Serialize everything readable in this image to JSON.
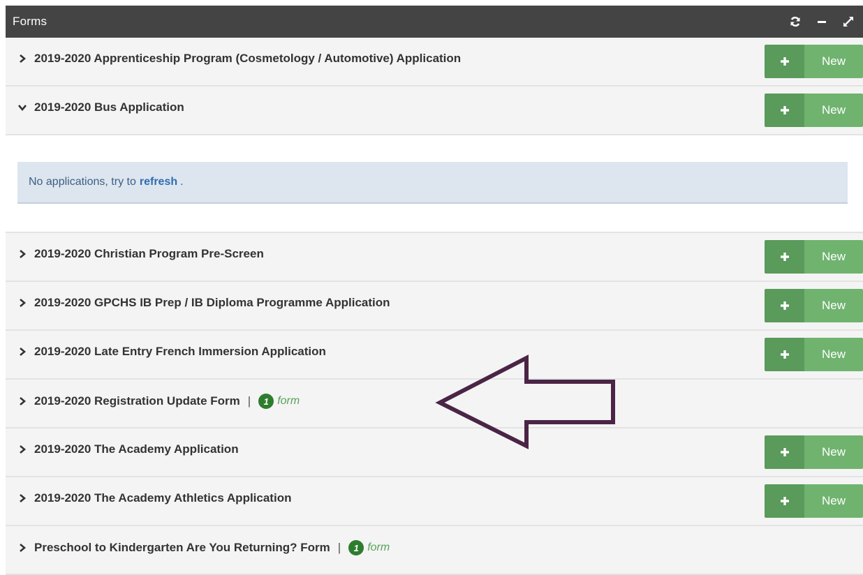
{
  "panel": {
    "title": "Forms",
    "tools": [
      "refresh-icon",
      "minimize-icon",
      "expand-icon"
    ]
  },
  "new_button_label": "New",
  "colors": {
    "header_bg": "#444444",
    "button_dark": "#5a9a5a",
    "button_light": "#6fb36f",
    "badge": "#2e7d2e",
    "arrow": "#4a2545",
    "alert_bg": "#dde5ef"
  },
  "forms": [
    {
      "title": "2019-2020 Apprenticeship Program (Cosmetology / Automotive) Application",
      "expanded": false,
      "has_new": true
    },
    {
      "title": "2019-2020 Bus Application",
      "expanded": true,
      "has_new": true
    },
    {
      "title": "2019-2020 Christian Program Pre-Screen",
      "expanded": false,
      "has_new": true
    },
    {
      "title": "2019-2020 GPCHS IB Prep / IB Diploma Programme Application",
      "expanded": false,
      "has_new": true
    },
    {
      "title": "2019-2020 Late Entry French Immersion Application",
      "expanded": false,
      "has_new": true
    },
    {
      "title": "2019-2020 Registration Update Form",
      "expanded": false,
      "has_new": false,
      "separator": "|",
      "count": "1",
      "count_label": "form"
    },
    {
      "title": "2019-2020 The Academy Application",
      "expanded": false,
      "has_new": true
    },
    {
      "title": "2019-2020 The Academy Athletics Application",
      "expanded": false,
      "has_new": true
    },
    {
      "title": "Preschool to Kindergarten Are You Returning? Form",
      "expanded": false,
      "has_new": false,
      "separator": "|",
      "count": "1",
      "count_label": "form"
    }
  ],
  "bus_alert": {
    "text": "No applications, try to",
    "link": "refresh",
    "trailing": "."
  }
}
